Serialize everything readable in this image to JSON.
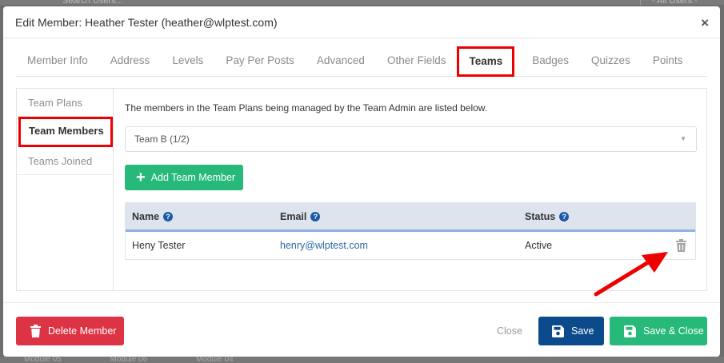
{
  "background": {
    "search_text": "Search Users...",
    "filter_text": "- All Users -",
    "bottom_items": [
      "Module 05",
      "Module 06",
      "Module 04"
    ]
  },
  "modal": {
    "title": "Edit Member: Heather Tester (heather@wlptest.com)",
    "close_symbol": "×"
  },
  "tabs": [
    {
      "label": "Member Info"
    },
    {
      "label": "Address"
    },
    {
      "label": "Levels"
    },
    {
      "label": "Pay Per Posts"
    },
    {
      "label": "Advanced"
    },
    {
      "label": "Other Fields"
    },
    {
      "label": "Teams"
    },
    {
      "label": "Badges"
    },
    {
      "label": "Quizzes"
    },
    {
      "label": "Points"
    }
  ],
  "active_tab": "Teams",
  "sidenav": {
    "items": [
      {
        "label": "Team Plans"
      },
      {
        "label": "Team Members"
      },
      {
        "label": "Teams Joined"
      }
    ],
    "active": "Team Members"
  },
  "content": {
    "description": "The members in the Team Plans being managed by the Team Admin are listed below.",
    "team_select": {
      "value": "Team B (1/2)"
    },
    "add_button_label": "Add Team Member"
  },
  "table": {
    "headers": {
      "name": "Name",
      "email": "Email",
      "status": "Status"
    },
    "help_symbol": "?",
    "rows": [
      {
        "name": "Heny Tester",
        "email": "henry@wlptest.com",
        "status": "Active"
      }
    ]
  },
  "footer": {
    "delete_label": "Delete Member",
    "close_label": "Close",
    "save_label": "Save",
    "save_close_label": "Save & Close"
  },
  "colors": {
    "highlight": "#ee0000",
    "delete": "#dd3445",
    "save": "#0b4a8b",
    "success": "#26b97a",
    "link": "#2e6aa6"
  }
}
